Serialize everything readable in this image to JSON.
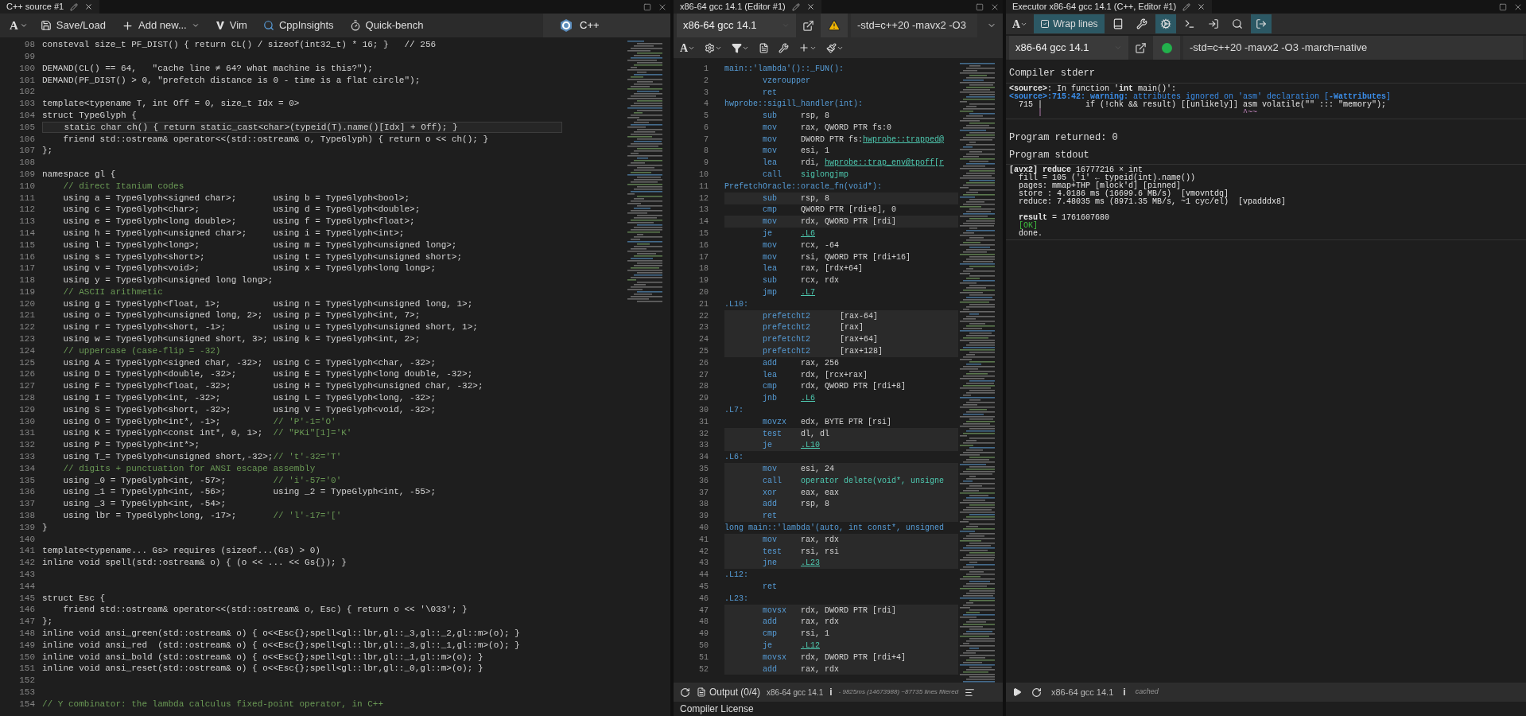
{
  "source": {
    "tab": "C++ source #1",
    "toolbar": [
      {
        "kind": "font",
        "label": "A"
      },
      {
        "kind": "save",
        "label": "Save/Load"
      },
      {
        "kind": "add",
        "label": "Add new..."
      },
      {
        "kind": "vim",
        "label": "Vim"
      },
      {
        "kind": "insights",
        "label": "CppInsights"
      },
      {
        "kind": "bench",
        "label": "Quick-bench"
      }
    ],
    "language": "C++",
    "lines": [
      {
        "n": "98",
        "kind": "code",
        "text": "consteval size_t PF_DIST() { return CL() / sizeof(int32_t) * 16; }   // 256",
        "current": false
      },
      {
        "n": "99",
        "current": false
      },
      {
        "n": "100",
        "kind": "code",
        "text": "DEMAND(CL() == 64,   \"cache line ≠ 64? what machine is this?\");",
        "current": false
      },
      {
        "n": "101",
        "kind": "code",
        "text": "DEMAND(PF_DIST() > 0, \"prefetch distance is 0 - time is a flat circle\");",
        "current": false
      },
      {
        "n": "102",
        "current": false
      },
      {
        "n": "103",
        "kind": "code",
        "text": "template<typename T, int Off = 0, size_t Idx = 0>",
        "current": false
      },
      {
        "n": "104",
        "kind": "code",
        "text": "struct TypeGlyph {",
        "current": false
      },
      {
        "n": "105",
        "kind": "code",
        "text": "    static char ch() { return static_cast<char>(typeid(T).name()[Idx] + Off); }",
        "current": true
      },
      {
        "n": "106",
        "kind": "code",
        "text": "    friend std::ostream& operator<<(std::ostream& o, TypeGlyph) { return o << ch(); }",
        "current": false
      },
      {
        "n": "107",
        "kind": "code",
        "text": "};",
        "current": false
      },
      {
        "n": "108",
        "current": false
      },
      {
        "n": "109",
        "kind": "code",
        "text": "namespace gl {",
        "current": false
      },
      {
        "n": "110",
        "kind": "comment",
        "text": "    // direct Itanium codes",
        "current": false
      },
      {
        "n": "111",
        "kind": "code",
        "text": "    using a = TypeGlyph<signed char>;",
        "col_2": "using b = TypeGlyph<bool>;",
        "current": false
      },
      {
        "n": "112",
        "kind": "code",
        "text": "    using c = TypeGlyph<char>;",
        "col_2": "using d = TypeGlyph<double>;",
        "current": false
      },
      {
        "n": "113",
        "kind": "code",
        "text": "    using e = TypeGlyph<long double>;",
        "col_2": "using f = TypeGlyph<float>;",
        "current": false
      },
      {
        "n": "114",
        "kind": "code",
        "text": "    using h = TypeGlyph<unsigned char>;",
        "col_2": "using i = TypeGlyph<int>;",
        "current": false
      },
      {
        "n": "115",
        "kind": "code",
        "text": "    using l = TypeGlyph<long>;",
        "col_2": "using m = TypeGlyph<unsigned long>;",
        "current": false
      },
      {
        "n": "116",
        "kind": "code",
        "text": "    using s = TypeGlyph<short>;",
        "col_2": "using t = TypeGlyph<unsigned short>;",
        "current": false
      },
      {
        "n": "117",
        "kind": "code",
        "text": "    using v = TypeGlyph<void>;",
        "col_2": "using x = TypeGlyph<long long>;",
        "current": false
      },
      {
        "n": "118",
        "kind": "code",
        "text": "    using y = TypeGlyph<unsigned long long>;",
        "current": false
      },
      {
        "n": "119",
        "kind": "comment",
        "text": "    // ASCII arithmetic",
        "current": false
      },
      {
        "n": "120",
        "kind": "code",
        "text": "    using g = TypeGlyph<float, 1>;",
        "col_2": "using n = TypeGlyph<unsigned long, 1>;",
        "current": false
      },
      {
        "n": "121",
        "kind": "code",
        "text": "    using o = TypeGlyph<unsigned long, 2>;",
        "col_2": "using p = TypeGlyph<int, 7>;",
        "current": false
      },
      {
        "n": "122",
        "kind": "code",
        "text": "    using r = TypeGlyph<short, -1>;",
        "col_2": "using u = TypeGlyph<unsigned short, 1>;",
        "current": false
      },
      {
        "n": "123",
        "kind": "code",
        "text": "    using w = TypeGlyph<unsigned short, 3>;",
        "col_2": "using k = TypeGlyph<int, 2>;",
        "current": false
      },
      {
        "n": "124",
        "kind": "comment",
        "text": "    // uppercase (case-flip = -32)",
        "current": false
      },
      {
        "n": "125",
        "kind": "code",
        "text": "    using A = TypeGlyph<signed char, -32>;",
        "col_2": "using C = TypeGlyph<char, -32>;",
        "current": false
      },
      {
        "n": "126",
        "kind": "code",
        "text": "    using D = TypeGlyph<double, -32>;",
        "col_2": "using E = TypeGlyph<long double, -32>;",
        "current": false
      },
      {
        "n": "127",
        "kind": "code",
        "text": "    using F = TypeGlyph<float, -32>;",
        "col_2": "using H = TypeGlyph<unsigned char, -32>;",
        "current": false
      },
      {
        "n": "128",
        "kind": "code",
        "text": "    using I = TypeGlyph<int, -32>;",
        "col_2": "using L = TypeGlyph<long, -32>;",
        "current": false
      },
      {
        "n": "129",
        "kind": "code",
        "text": "    using S = TypeGlyph<short, -32>;",
        "col_2": "using V = TypeGlyph<void, -32>;",
        "current": false
      },
      {
        "n": "130",
        "kind": "code",
        "text": "    using O = TypeGlyph<int*, -1>;",
        "note": "// 'P'-1='O'",
        "current": false
      },
      {
        "n": "131",
        "kind": "code",
        "text": "    using K = TypeGlyph<const int*, 0, 1>;",
        "note": "// \"PKi\"[1]='K'",
        "current": false
      },
      {
        "n": "132",
        "kind": "code",
        "text": "    using P = TypeGlyph<int*>;",
        "current": false
      },
      {
        "n": "133",
        "kind": "code",
        "text": "    using T_= TypeGlyph<unsigned short,-32>;",
        "note": "// 't'-32='T'",
        "current": false
      },
      {
        "n": "134",
        "kind": "comment",
        "text": "    // digits + punctuation for ANSI escape assembly",
        "current": false
      },
      {
        "n": "135",
        "kind": "code",
        "text": "    using _0 = TypeGlyph<int, -57>;",
        "note": "// 'i'-57='0'",
        "current": false
      },
      {
        "n": "136",
        "kind": "code",
        "text": "    using _1 = TypeGlyph<int, -56>;",
        "col_2": "using _2 = TypeGlyph<int, -55>;",
        "current": false
      },
      {
        "n": "137",
        "kind": "code",
        "text": "    using _3 = TypeGlyph<int, -54>;",
        "current": false
      },
      {
        "n": "138",
        "kind": "code",
        "text": "    using lbr = TypeGlyph<long, -17>;",
        "note": "// 'l'-17='['",
        "current": false
      },
      {
        "n": "139",
        "kind": "code",
        "text": "}",
        "current": false
      },
      {
        "n": "140",
        "current": false
      },
      {
        "n": "141",
        "kind": "code",
        "text": "template<typename... Gs> requires (sizeof...(Gs) > 0)",
        "current": false
      },
      {
        "n": "142",
        "kind": "code",
        "text": "inline void spell(std::ostream& o) { (o << ... << Gs{}); }",
        "current": false
      },
      {
        "n": "143",
        "current": false
      },
      {
        "n": "144",
        "current": false
      },
      {
        "n": "145",
        "kind": "code",
        "text": "struct Esc {",
        "current": false
      },
      {
        "n": "146",
        "kind": "code",
        "text": "    friend std::ostream& operator<<(std::ostream& o, Esc) { return o << '\\033'; }",
        "current": false
      },
      {
        "n": "147",
        "kind": "code",
        "text": "};",
        "current": false
      },
      {
        "n": "148",
        "kind": "code",
        "text": "inline void ansi_green(std::ostream& o) { o<<Esc{};spell<gl::lbr,gl::_3,gl::_2,gl::m>(o); }",
        "current": false
      },
      {
        "n": "149",
        "kind": "code",
        "text": "inline void ansi_red  (std::ostream& o) { o<<Esc{};spell<gl::lbr,gl::_3,gl::_1,gl::m>(o); }",
        "current": false
      },
      {
        "n": "150",
        "kind": "code",
        "text": "inline void ansi_bold (std::ostream& o) { o<<Esc{};spell<gl::lbr,gl::_1,gl::m>(o); }",
        "current": false
      },
      {
        "n": "151",
        "kind": "code",
        "text": "inline void ansi_reset(std::ostream& o) { o<<Esc{};spell<gl::lbr,gl::_0,gl::m>(o); }",
        "current": false
      },
      {
        "n": "152",
        "current": false
      },
      {
        "n": "153",
        "current": false
      },
      {
        "n": "154",
        "kind": "comment",
        "text": "// Y combinator: the lambda calculus fixed-point operator, in C++",
        "current": false
      }
    ]
  },
  "compiler": {
    "tab": "x86-64 gcc 14.1 (Editor #1)",
    "toolbar_font": "A",
    "compiler": "x86-64 gcc 14.1",
    "warnings": true,
    "options": "-std=c++20 -mavx2 -O3",
    "lines": [
      {
        "n": "1",
        "label": "main::'lambda'()::_FUN():",
        "shaded": false
      },
      {
        "n": "2",
        "op": "vzeroupper",
        "shaded": false
      },
      {
        "n": "3",
        "op": "ret",
        "shaded": false
      },
      {
        "n": "4",
        "label": "hwprobe::sigill_handler(int):",
        "shaded": false
      },
      {
        "n": "5",
        "op": "sub",
        "args": "rsp, 8",
        "shaded": false
      },
      {
        "n": "6",
        "op": "mov",
        "args": "rax, QWORD PTR fs:0",
        "shaded": false
      },
      {
        "n": "7",
        "op": "mov",
        "args": "DWORD PTR fs:",
        "target": "hwprobe::trapped@",
        "shaded": false
      },
      {
        "n": "8",
        "op": "mov",
        "args": "esi, 1",
        "shaded": false
      },
      {
        "n": "9",
        "op": "lea",
        "args": "rdi, ",
        "target": "hwprobe::trap_env@tpoff[r",
        "shaded": false
      },
      {
        "n": "10",
        "op": "call",
        "symbol": "siglongjmp",
        "shaded": false
      },
      {
        "n": "11",
        "label": "PrefetchOracle::oracle_fn(void*):",
        "shaded": false
      },
      {
        "n": "12",
        "op": "sub",
        "args": "rsp, 8",
        "shaded": true
      },
      {
        "n": "13",
        "op": "cmp",
        "args": "QWORD PTR [rdi+8], 0",
        "shaded": false
      },
      {
        "n": "14",
        "op": "mov",
        "args": "rdx, QWORD PTR [rdi]",
        "shaded": true
      },
      {
        "n": "15",
        "op": "je",
        "target": ".L6",
        "shaded": false
      },
      {
        "n": "16",
        "op": "mov",
        "args": "rcx, -64",
        "shaded": false
      },
      {
        "n": "17",
        "op": "mov",
        "args": "rsi, QWORD PTR [rdi+16]",
        "shaded": false
      },
      {
        "n": "18",
        "op": "lea",
        "args": "rax, [rdx+64]",
        "shaded": false
      },
      {
        "n": "19",
        "op": "sub",
        "args": "rcx, rdx",
        "shaded": false
      },
      {
        "n": "20",
        "op": "jmp",
        "target": ".L7",
        "shaded": false
      },
      {
        "n": "21",
        "label": ".L10:",
        "shaded": false
      },
      {
        "n": "22",
        "op": "prefetcht2",
        "args": "[rax-64]",
        "shaded": true
      },
      {
        "n": "23",
        "op": "prefetcht2",
        "args": "[rax]",
        "shaded": true
      },
      {
        "n": "24",
        "op": "prefetcht2",
        "args": "[rax+64]",
        "shaded": true
      },
      {
        "n": "25",
        "op": "prefetcht2",
        "args": "[rax+128]",
        "shaded": true
      },
      {
        "n": "26",
        "op": "add",
        "args": "rax, 256",
        "shaded": false
      },
      {
        "n": "27",
        "op": "lea",
        "args": "rdx, [rcx+rax]",
        "shaded": false
      },
      {
        "n": "28",
        "op": "cmp",
        "args": "rdx, QWORD PTR [rdi+8]",
        "shaded": false
      },
      {
        "n": "29",
        "op": "jnb",
        "target": ".L6",
        "shaded": false
      },
      {
        "n": "30",
        "label": ".L7:",
        "shaded": false
      },
      {
        "n": "31",
        "op": "movzx",
        "args": "edx, BYTE PTR [rsi]",
        "shaded": false
      },
      {
        "n": "32",
        "op": "test",
        "args": "dl, dl",
        "shaded": true
      },
      {
        "n": "33",
        "op": "je",
        "target": ".L10",
        "shaded": true
      },
      {
        "n": "34",
        "label": ".L6:",
        "shaded": false
      },
      {
        "n": "35",
        "op": "mov",
        "args": "esi, 24",
        "shaded": true
      },
      {
        "n": "36",
        "op": "call",
        "symbol": "operator delete(void*, unsigne",
        "shaded": true
      },
      {
        "n": "37",
        "op": "xor",
        "args": "eax, eax",
        "shaded": true
      },
      {
        "n": "38",
        "op": "add",
        "args": "rsp, 8",
        "shaded": true
      },
      {
        "n": "39",
        "op": "ret",
        "shaded": true
      },
      {
        "n": "40",
        "label": "long main::'lambda'(auto, int const*, unsigned",
        "shaded": false
      },
      {
        "n": "41",
        "op": "mov",
        "args": "rax, rdx",
        "shaded": true
      },
      {
        "n": "42",
        "op": "test",
        "args": "rsi, rsi",
        "shaded": true
      },
      {
        "n": "43",
        "op": "jne",
        "target": ".L23",
        "shaded": true
      },
      {
        "n": "44",
        "label": ".L12:",
        "shaded": false
      },
      {
        "n": "45",
        "op": "ret",
        "shaded": false
      },
      {
        "n": "46",
        "label": ".L23:",
        "shaded": false
      },
      {
        "n": "47",
        "op": "movsx",
        "args": "rdx, DWORD PTR [rdi]",
        "shaded": true
      },
      {
        "n": "48",
        "op": "add",
        "args": "rax, rdx",
        "shaded": true
      },
      {
        "n": "49",
        "op": "cmp",
        "args": "rsi, 1",
        "shaded": true
      },
      {
        "n": "50",
        "op": "je",
        "target": ".L12",
        "shaded": true
      },
      {
        "n": "51",
        "op": "movsx",
        "args": "rdx, DWORD PTR [rdi+4]",
        "shaded": true
      },
      {
        "n": "52",
        "op": "add",
        "args": "rax, rdx",
        "shaded": true
      }
    ],
    "footer": {
      "output": "Output (0/4)",
      "compiler": "x86-64 gcc 14.1",
      "info": "i",
      "stats": "- 9825ms (14673988) ~87735 lines filtered"
    },
    "license": "Compiler License"
  },
  "executor": {
    "tab": "Executor x86-64 gcc 14.1 (C++, Editor #1)",
    "toolbar": [
      {
        "kind": "font",
        "label": "A",
        "active": false
      },
      {
        "kind": "wrap",
        "label": "Wrap lines",
        "checked": true,
        "active": true
      },
      {
        "kind": "libraries",
        "active": false
      },
      {
        "kind": "tools",
        "active": false
      },
      {
        "kind": "compiler_options",
        "active": true
      },
      {
        "kind": "arguments",
        "active": false
      },
      {
        "kind": "stdin",
        "active": false
      },
      {
        "kind": "compiler_output",
        "active": false
      },
      {
        "kind": "execution_output",
        "active": true
      }
    ],
    "compiler": "x86-64 gcc 14.1",
    "warnings": false,
    "options": "-std=c++20 -mavx2 -O3 -march=native",
    "stderr_title": "Compiler stderr",
    "stderr": [
      {
        "kind": "plain",
        "text": "**<source>**: In function '**int** main()':"
      },
      {
        "kind": "warning",
        "text": "**<source>:715:42: warning:** attributes ignored on 'asm' declaration [**-Wattributes**]"
      },
      {
        "kind": "plain",
        "text": "  715 |         if (!chk && result) [[unlikely]] asm volatile(\"\" ::: \"memory\");"
      },
      {
        "kind": "caret",
        "text": "      |                                          ^~~"
      }
    ],
    "returned": "Program returned: 0",
    "stdout_title": "Program stdout",
    "stdout": [
      {
        "kind": "plain",
        "text": "**[avx2] reduce** 16777216 × int"
      },
      {
        "kind": "plain",
        "text": "  fill = 105 ('i' ← typeid(int).name())"
      },
      {
        "kind": "plain",
        "text": "  pages: mmap+THP [mlock'd] [pinned]"
      },
      {
        "kind": "plain",
        "text": "  store : 4.0186 ms (16699.6 MB/s)  [vmovntdq]"
      },
      {
        "kind": "plain",
        "text": "  reduce: 7.48035 ms (8971.35 MB/s, ~1 cyc/el)  [vpadddx8]"
      },
      {
        "kind": "gap"
      },
      {
        "kind": "plain",
        "text": "  **result** = 1761607680"
      },
      {
        "kind": "ok",
        "text": "  [OK]"
      },
      {
        "kind": "plain",
        "text": "  done."
      }
    ],
    "footer": {
      "compiler": "x86-64 gcc 14.1",
      "info": "i",
      "cache": "cached"
    }
  }
}
